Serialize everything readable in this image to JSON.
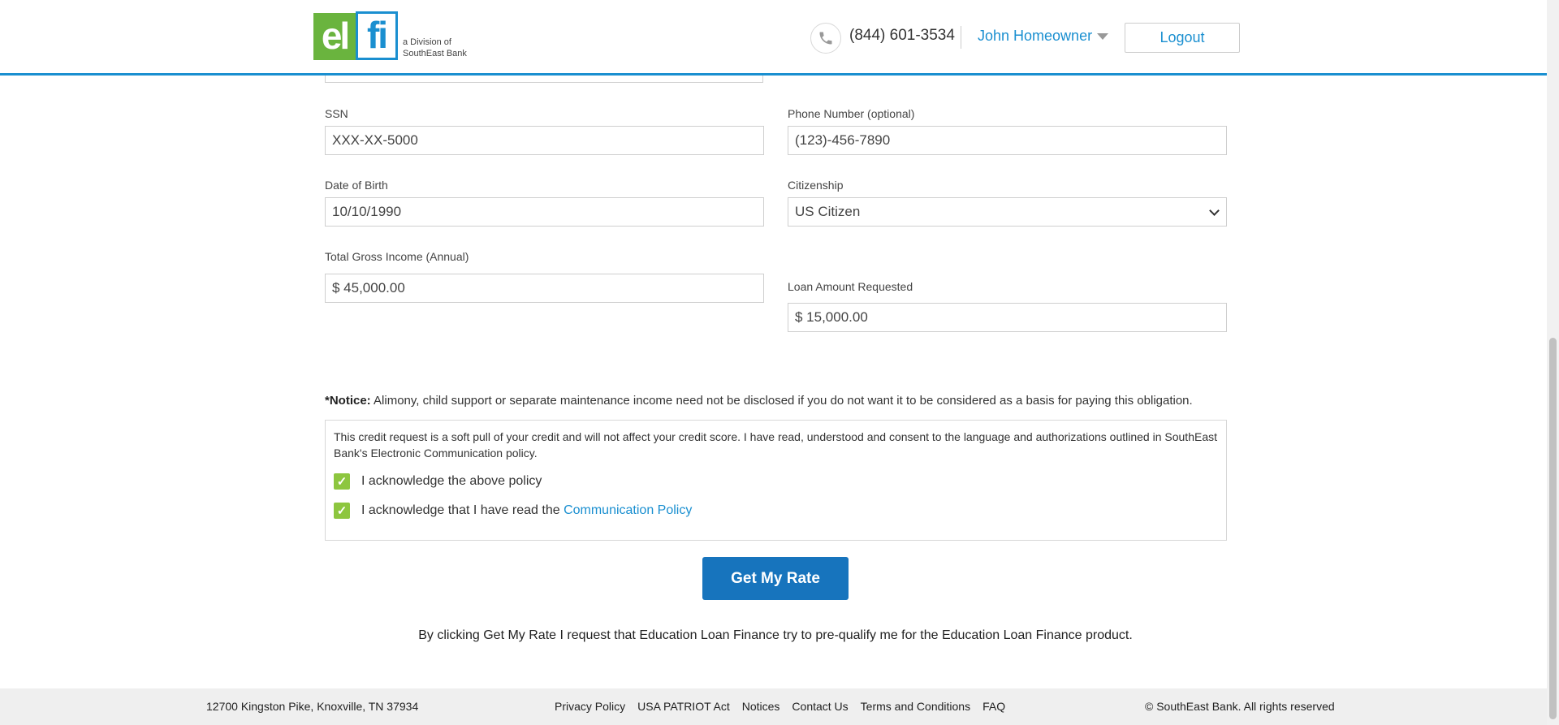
{
  "header": {
    "logo": {
      "part1": "el",
      "part2": "fi",
      "division_line1": "a Division of",
      "division_line2": "SouthEast Bank"
    },
    "phone": "(844) 601-3534",
    "user_name": "John Homeowner",
    "logout_label": "Logout"
  },
  "form": {
    "ssn": {
      "label": "SSN",
      "value": "XXX-XX-5000"
    },
    "phone": {
      "label": "Phone Number (optional)",
      "value": "(123)-456-7890"
    },
    "dob": {
      "label": "Date of Birth",
      "value": "10/10/1990"
    },
    "citizenship": {
      "label": "Citizenship",
      "value": "US Citizen"
    },
    "income": {
      "label": "Total Gross Income (Annual)",
      "value": "$ 45,000.00"
    },
    "loan": {
      "label": "Loan Amount Requested",
      "value": "$ 15,000.00"
    }
  },
  "notice": {
    "prefix": "*Notice:",
    "text": " Alimony, child support or separate maintenance income need not be disclosed if you do not want it to be considered as a basis for paying this obligation."
  },
  "consent": {
    "text": "This credit request is a soft pull of your credit and will not affect your credit score. I have read, understood and consent to the language and authorizations outlined in SouthEast Bank's Electronic Communication policy.",
    "check1": {
      "label": "I acknowledge the above policy",
      "checked": true
    },
    "check2": {
      "label": "I acknowledge that I have read the ",
      "link": "Communication Policy",
      "checked": true
    }
  },
  "submit_label": "Get My Rate",
  "disclaimer": "By clicking Get My Rate I request that Education Loan Finance try to pre-qualify me for the Education Loan Finance product.",
  "footer": {
    "address": "12700 Kingston Pike, Knoxville, TN 37934",
    "links": [
      "Privacy Policy",
      "USA PATRIOT Act",
      "Notices",
      "Contact Us",
      "Terms and Conditions",
      "FAQ"
    ],
    "copyright": "© SouthEast Bank. All rights reserved"
  },
  "colors": {
    "brand_blue": "#1a8fd0",
    "brand_green": "#6ab43e",
    "button_blue": "#1774bd",
    "check_green": "#8dc63f"
  }
}
